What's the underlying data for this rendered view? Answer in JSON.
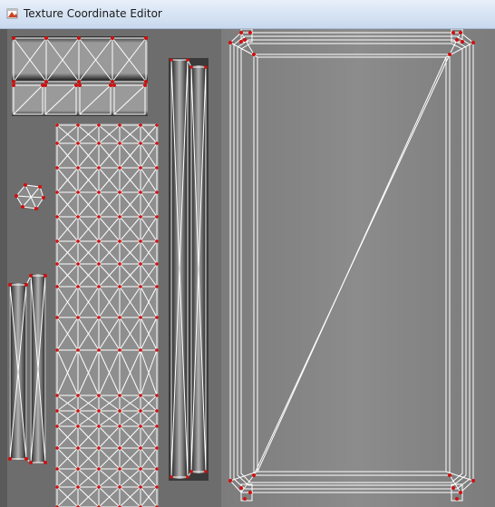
{
  "window": {
    "title": "Texture Coordinate Editor",
    "icon": "texture-editor-app-icon"
  },
  "colors": {
    "title_bg": "#d7e4f4",
    "canvas_bg": "#6d6d6d",
    "texture_light": "#8a8a8a",
    "texture_dark": "#1e1e1e",
    "uv_edge": "#ffffff",
    "uv_vertex": "#d01010"
  },
  "canvas": {
    "content": "uv-layout-islands"
  }
}
